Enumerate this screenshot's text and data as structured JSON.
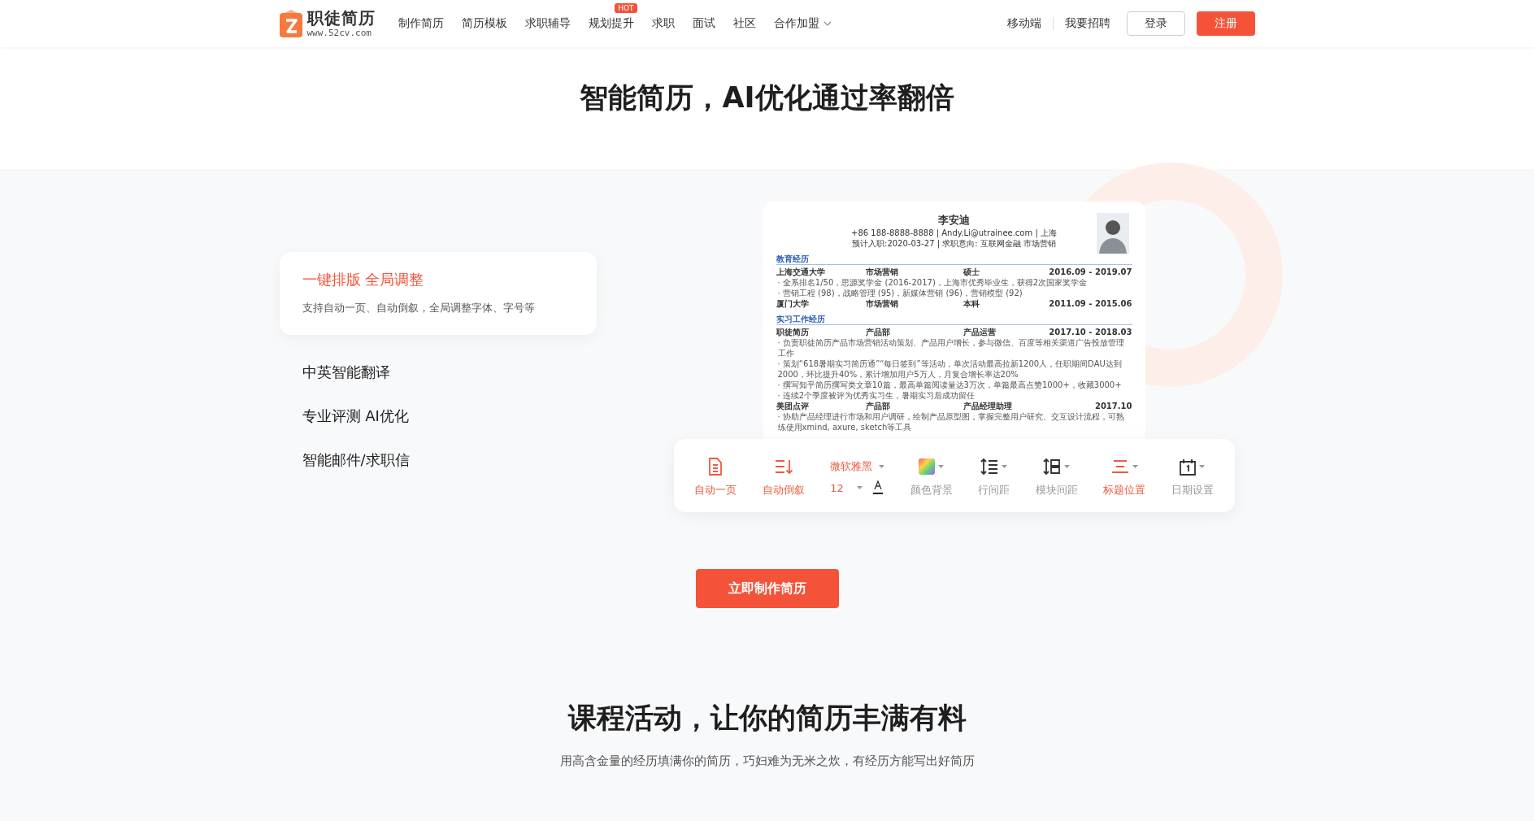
{
  "header": {
    "logo": {
      "name": "职徒简历",
      "url": "www.52cv.com"
    },
    "nav": [
      {
        "label": "制作简历",
        "has_menu": false
      },
      {
        "label": "简历模板",
        "has_menu": false
      },
      {
        "label": "求职辅导",
        "has_menu": false
      },
      {
        "label": "规划提升",
        "badge": "HOT",
        "has_menu": false
      },
      {
        "label": "求职",
        "has_menu": false
      },
      {
        "label": "面试",
        "has_menu": false
      },
      {
        "label": "社区",
        "has_menu": false
      },
      {
        "label": "合作加盟",
        "has_menu": true
      }
    ],
    "links": [
      "移动端",
      "我要招聘"
    ],
    "login": "登录",
    "register": "注册"
  },
  "hero": {
    "title": "智能简历，AI优化通过率翻倍"
  },
  "features": [
    {
      "title": "一键排版 全局调整",
      "description": "支持自动一页、自动倒叙，全局调整字体、字号等",
      "selected": true
    },
    {
      "title": "中英智能翻译",
      "selected": false
    },
    {
      "title": "专业评测 AI优化",
      "selected": false
    },
    {
      "title": "智能邮件/求职信",
      "selected": false
    }
  ],
  "resume": {
    "name": "李安迪",
    "contact": "+86 188-8888-8888  |  Andy.Li@utrainee.com  |  上海",
    "intention": "预计入职:2020-03-27 | 求职意向: 互联网金融 市场营销",
    "sections": [
      {
        "title": "教育经历",
        "entries": [
          {
            "cells": [
              "上海交通大学",
              "市场营销",
              "硕士",
              "2016.09 - 2019.07"
            ],
            "bullets": [
              "· 全系排名1/50，思源奖学金 (2016-2017)，上海市优秀毕业生，获得2次国家奖学金",
              "· 营销工程 (98)，战略管理 (95)，新媒体营销 (96)，营销模型 (92)"
            ]
          },
          {
            "cells": [
              "厦门大学",
              "市场营销",
              "本科",
              "2011.09 - 2015.06"
            ]
          }
        ]
      },
      {
        "title": "实习工作经历",
        "entries": [
          {
            "cells": [
              "职徒简历",
              "产品部",
              "产品运营",
              "2017.10 - 2018.03"
            ],
            "bullets": [
              "· 负责职徒简历产品市场营销活动策划、产品用户增长，参与微信、百度等相关渠道广告投放管理工作",
              "· 策划“618暑期实习简历通”“每日签到”等活动，单次活动最高拉新1200人，任职期间DAU达到2000，环比提升40%，累计增加用户5万人，月复合增长率达20%",
              "· 撰写知乎简历撰写类文章10篇，最高单篇阅读量达3万次，单篇最高点赞1000+，收藏3000+",
              "· 连续2个季度被评为优秀实习生，暑期实习后成功留任"
            ]
          },
          {
            "cells": [
              "美团点评",
              "产品部",
              "产品经理助理",
              "2017.10"
            ],
            "bullets": [
              "· 协助产品经理进行市场和用户调研，绘制产品原型图，掌握完整用户研究、交互设计流程，可熟练使用xmind, axure, sketch等工具"
            ]
          }
        ]
      }
    ]
  },
  "toolbar": [
    {
      "kind": "button",
      "label": "自动一页",
      "highlighted": true
    },
    {
      "kind": "button",
      "label": "自动倒叙",
      "highlighted": true
    },
    {
      "kind": "font",
      "font": "微软雅黑",
      "size": "12",
      "highlighted": true
    },
    {
      "kind": "button",
      "label": "颜色背景",
      "highlighted": false
    },
    {
      "kind": "button",
      "label": "行间距",
      "highlighted": false
    },
    {
      "kind": "button",
      "label": "模块间距",
      "highlighted": false
    },
    {
      "kind": "button",
      "label": "标题位置",
      "highlighted": true
    },
    {
      "kind": "button",
      "label": "日期设置",
      "highlighted": false
    }
  ],
  "cta": "立即制作简历",
  "courses": {
    "title": "课程活动，让你的简历丰满有料",
    "subtitle": "用高含金量的经历填满你的简历，巧妇难为无米之炊，有经历方能写出好简历"
  }
}
